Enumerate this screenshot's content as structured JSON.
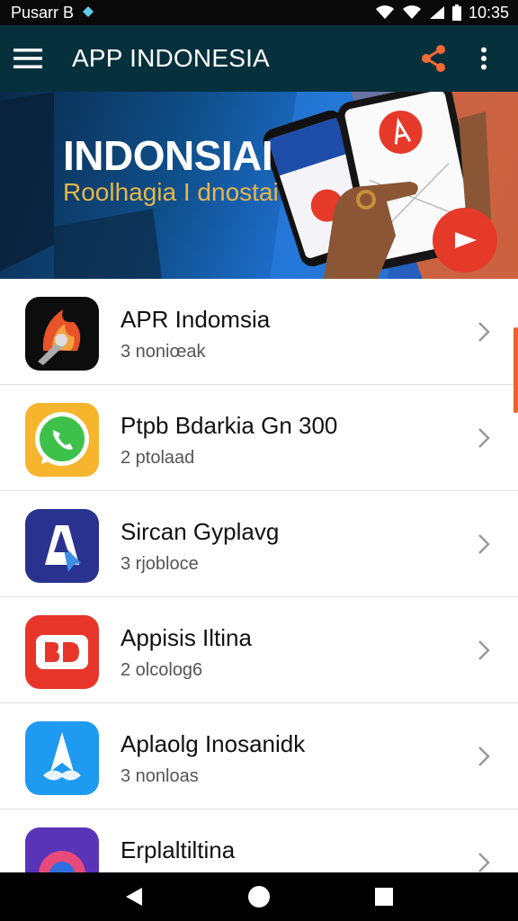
{
  "status_bar": {
    "carrier": "Pusarr B",
    "time": "10:35"
  },
  "app_bar": {
    "title": "APP INDONESIA"
  },
  "banner": {
    "title": "INDONSIAI",
    "subtitle": "Roolhagia I dnostai"
  },
  "apps": [
    {
      "title": "APR Indomsia",
      "subtitle": "3 noniœak",
      "icon": "fire-logo-icon"
    },
    {
      "title": "Ptpb Bdarkia Gn 300",
      "subtitle": "2 ptolaad",
      "icon": "whatsapp-icon"
    },
    {
      "title": "Sircan Gyplavg",
      "subtitle": "3 rjobloce",
      "icon": "pointer-logo-icon"
    },
    {
      "title": "Appisis Iltina",
      "subtitle": "2 olcolog6",
      "icon": "bd-logo-icon"
    },
    {
      "title": "Aplaolg Inosanidk",
      "subtitle": "3 nonloas",
      "icon": "star-logo-icon"
    },
    {
      "title": "Erplaltiltina",
      "subtitle": "",
      "icon": "gear-logo-icon"
    }
  ],
  "colors": {
    "app_bar": "#07303d",
    "accent": "#e8642c",
    "banner_text": "#e7b64a"
  }
}
